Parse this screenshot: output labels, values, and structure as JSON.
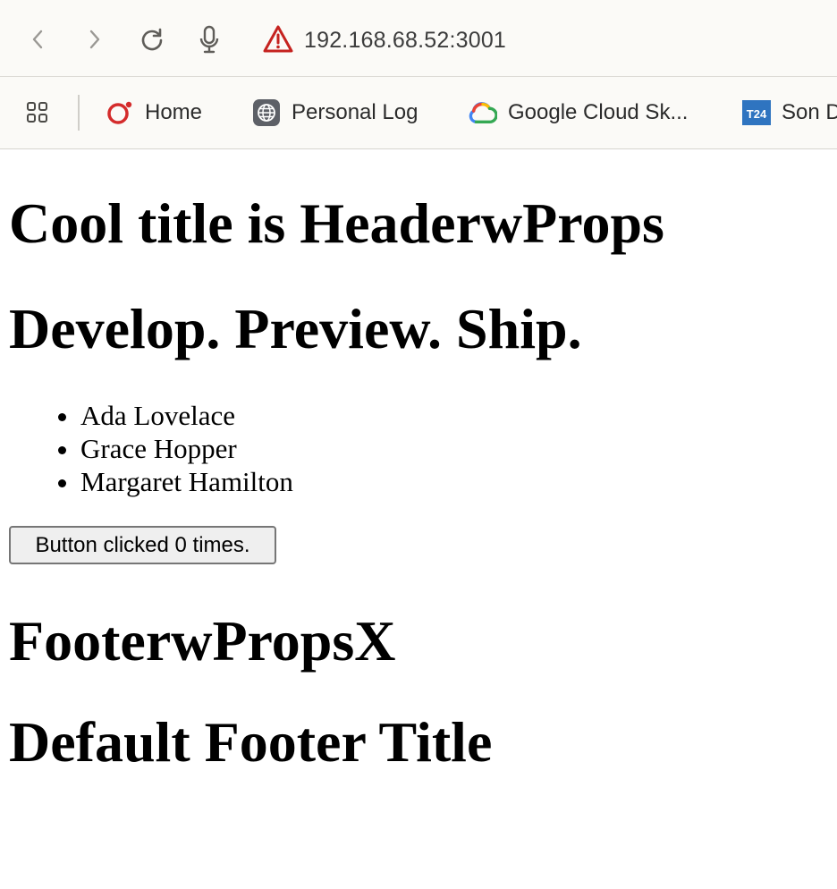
{
  "browser": {
    "address": "192.168.68.52:3001",
    "bookmarks": [
      {
        "label": "Home",
        "icon": "opera-icon"
      },
      {
        "label": "Personal Log",
        "icon": "globe-icon"
      },
      {
        "label": "Google Cloud Sk...",
        "icon": "google-cloud-icon"
      },
      {
        "label": "Son D",
        "icon": "t24-icon"
      }
    ],
    "t24_badge": "T24"
  },
  "page": {
    "header_title": "Cool title is HeaderwProps",
    "tagline": "Develop. Preview. Ship.",
    "names": [
      "Ada Lovelace",
      "Grace Hopper",
      "Margaret Hamilton"
    ],
    "button_label": "Button clicked 0 times.",
    "footer_title": "FooterwPropsX",
    "footer_default": "Default Footer Title"
  },
  "colors": {
    "warning": "#c5221f",
    "opera_red": "#d42b2b",
    "t24_blue": "#2f74c0"
  }
}
